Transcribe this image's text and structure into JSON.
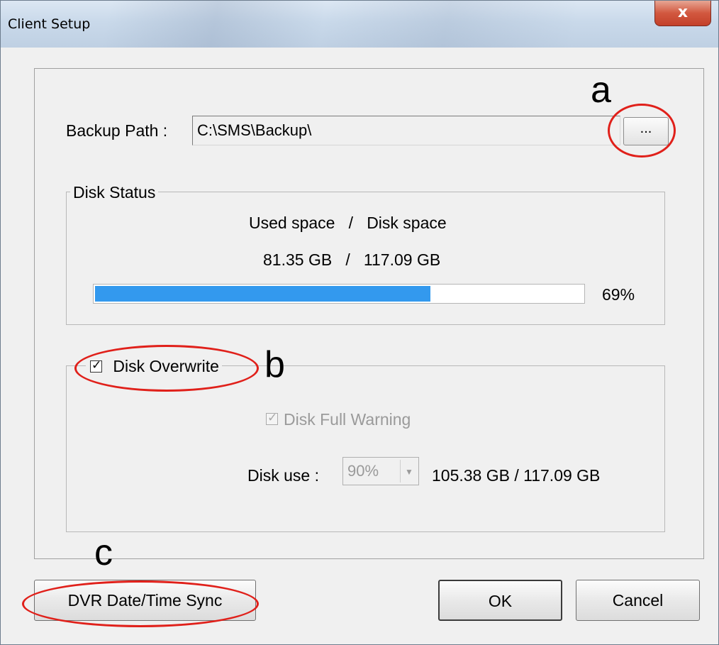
{
  "window": {
    "title": "Client Setup",
    "close_glyph": "x"
  },
  "backup": {
    "label": "Backup Path :",
    "path": "C:\\SMS\\Backup\\",
    "browse_label": "..."
  },
  "disk_status": {
    "group_title": "Disk Status",
    "header": "Used space   /   Disk space",
    "values": "81.35 GB   /   117.09 GB",
    "percent_label": "69%",
    "progress_fraction": 0.69
  },
  "overwrite": {
    "checkbox_label": "Disk Overwrite",
    "checked": true,
    "full_warning_label": "Disk Full Warning",
    "full_warning_checked": true,
    "disk_use_label": "Disk use :",
    "disk_use_value": "90%",
    "disk_use_size": "105.38 GB / 117.09 GB"
  },
  "buttons": {
    "sync": "DVR Date/Time Sync",
    "ok": "OK",
    "cancel": "Cancel"
  },
  "annotations": {
    "a": "a",
    "b": "b",
    "c": "c",
    "color": "#e0201a"
  },
  "icons": {
    "close": "close-icon",
    "dropdown": "chevron-down-icon",
    "check": "checkmark-icon"
  },
  "colors": {
    "progress_fill": "#3399ee",
    "dialog_bg": "#f0f0f0"
  }
}
